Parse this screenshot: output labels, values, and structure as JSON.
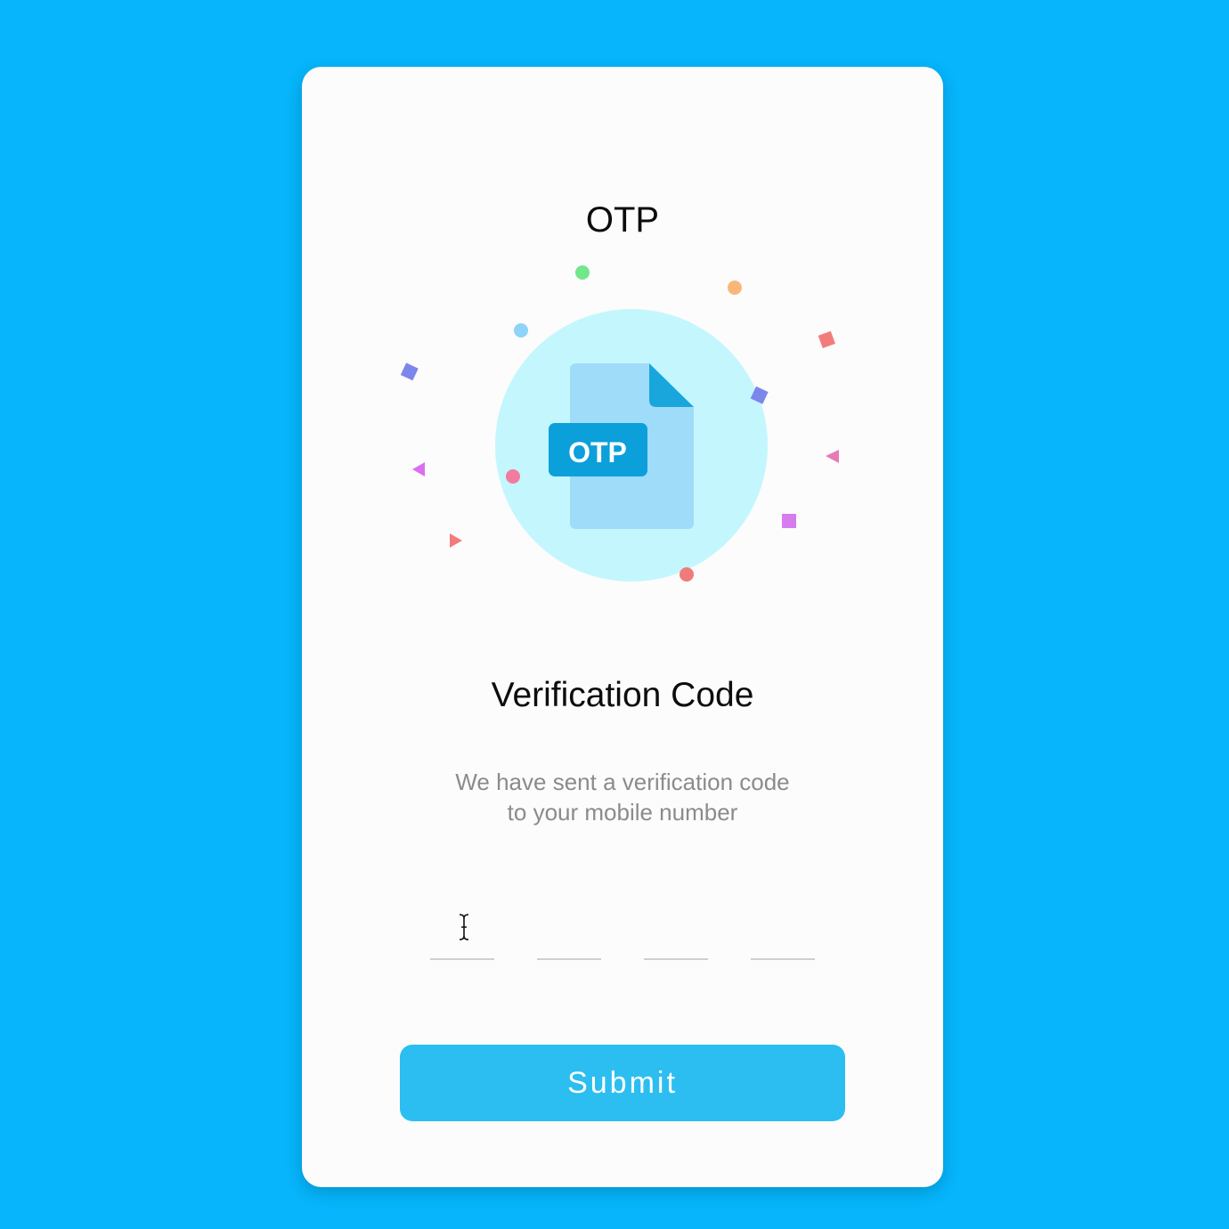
{
  "header": {
    "title": "OTP"
  },
  "illustration": {
    "badge_label": "OTP",
    "icon": "otp-document-icon",
    "colors": {
      "circle": "#c4f6fd",
      "document": "#9fdcf9",
      "document_fold": "#18a6dc",
      "badge": "#0ba0da"
    }
  },
  "content": {
    "heading": "Verification Code",
    "description_line1": "We have sent a verification code",
    "description_line2": "to your mobile number"
  },
  "otp": {
    "digit_count": 4,
    "values": [
      "",
      "",
      "",
      ""
    ]
  },
  "actions": {
    "submit_label": "Submit"
  },
  "colors": {
    "page_background": "#06b5fb",
    "card_background": "#fcfcfc",
    "button": "#2cbef0",
    "muted_text": "#8b8b8b"
  }
}
